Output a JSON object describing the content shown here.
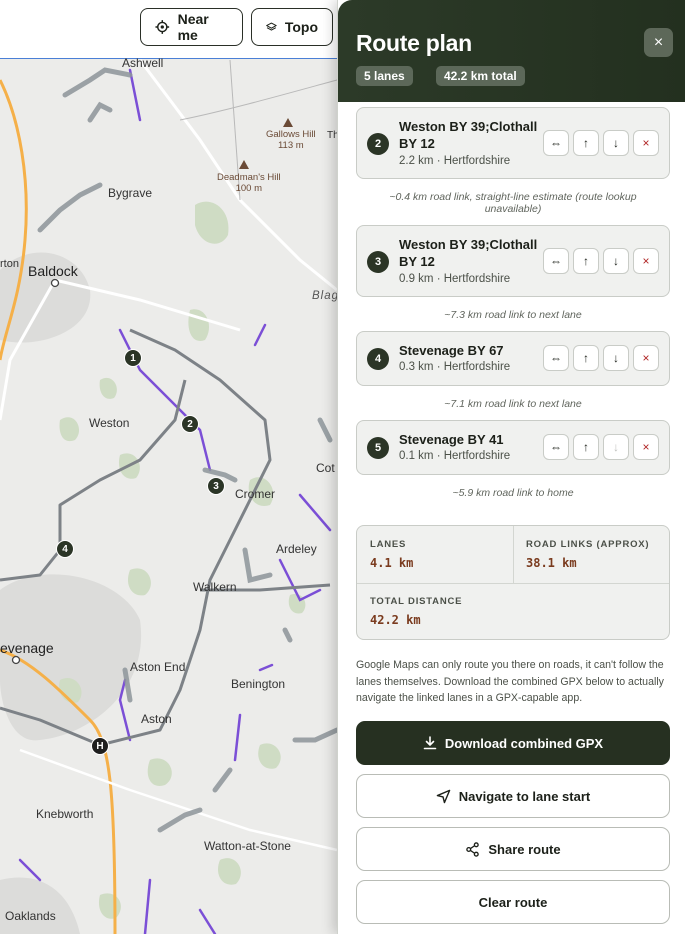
{
  "toolbar": {
    "near_me_label": "Near me",
    "topo_label": "Topo"
  },
  "map": {
    "place_labels": {
      "ashwell": "Ashwell",
      "bygrave": "Bygrave",
      "baldock": "Baldock",
      "orton": "rton",
      "blag": "Blag",
      "weston": "Weston",
      "cromer": "Cromer",
      "cot": "Cot",
      "ardeley": "Ardeley",
      "walkern": "Walkern",
      "stevenage": "evenage",
      "aston_end": "Aston End",
      "aston": "Aston",
      "benington": "Benington",
      "knebworth": "Knebworth",
      "watton": "Watton-at-Stone",
      "oaklands": "Oaklands",
      "th": "Th"
    },
    "hills": [
      {
        "name": "Gallows Hill",
        "height": "113 m"
      },
      {
        "name": "Deadman's Hill",
        "height": "100 m"
      }
    ],
    "markers": [
      "1",
      "2",
      "3",
      "4"
    ],
    "home_marker": "H",
    "colors": {
      "lane": "#7b4fd6",
      "route": "#7d8287",
      "road_major": "#f5b049",
      "background": "#ececea"
    }
  },
  "panel": {
    "title": "Route plan",
    "lanes_pill": "5 lanes",
    "total_pill": "42.2 km total",
    "close_icon": "×",
    "lanes": [
      {
        "num": "2",
        "name": "Weston BY 39;Clothall BY 12",
        "meta": "2.2 km · Hertfordshire",
        "link_after": "~0.4 km road link, straight-line estimate (route lookup unavailable)"
      },
      {
        "num": "3",
        "name": "Weston BY 39;Clothall BY 12",
        "meta": "0.9 km · Hertfordshire",
        "link_after": "~7.3 km road link to next lane"
      },
      {
        "num": "4",
        "name": "Stevenage BY 67",
        "meta": "0.3 km · Hertfordshire",
        "link_after": "~7.1 km road link to next lane"
      },
      {
        "num": "5",
        "name": "Stevenage BY 41",
        "meta": "0.1 km · Hertfordshire",
        "link_after": "~5.9 km road link to home"
      }
    ],
    "actions": {
      "reverse": "⇔",
      "up": "↑",
      "down": "↓",
      "remove": "×"
    },
    "stats": {
      "lanes_label": "LANES",
      "lanes_value": "4.1 km",
      "road_label": "ROAD LINKS (APPROX)",
      "road_value": "38.1 km",
      "total_label": "TOTAL DISTANCE",
      "total_value": "42.2 km"
    },
    "note": "Google Maps can only route you there on roads, it can't follow the lanes themselves. Download the combined GPX below to actually navigate the linked lanes in a GPX-capable app.",
    "buttons": {
      "download": "Download combined GPX",
      "navigate": "Navigate to lane start",
      "share": "Share route",
      "clear": "Clear route"
    }
  }
}
